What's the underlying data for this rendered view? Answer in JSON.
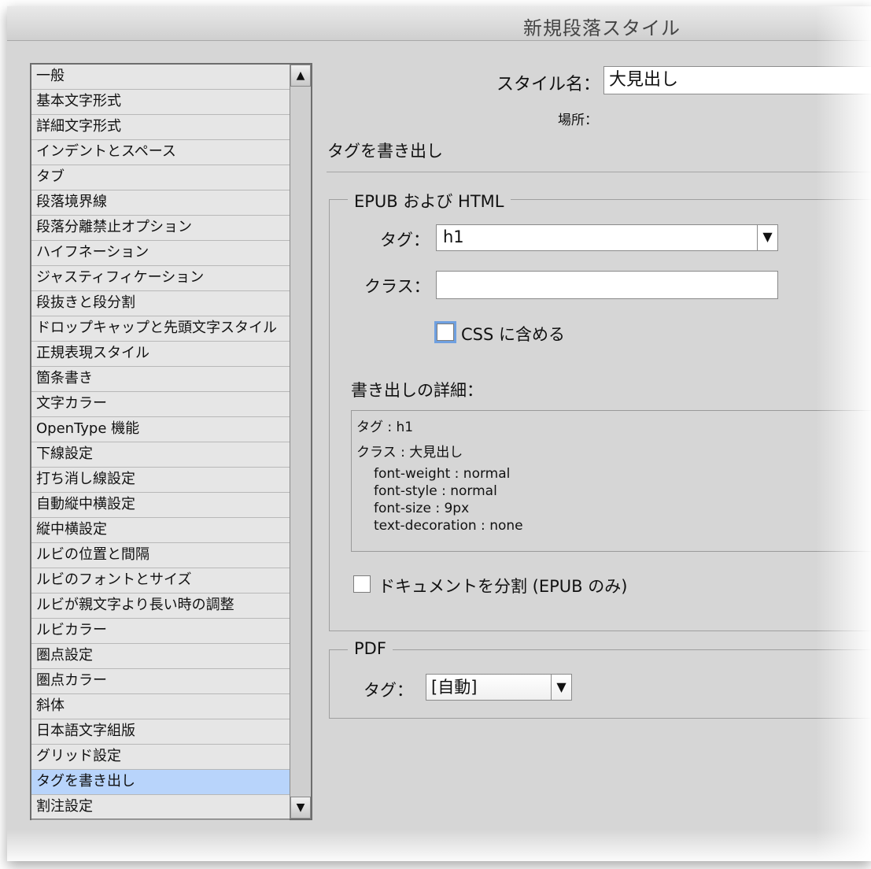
{
  "dialog": {
    "title": "新規段落スタイル"
  },
  "categories": [
    "一般",
    "基本文字形式",
    "詳細文字形式",
    "インデントとスペース",
    "タブ",
    "段落境界線",
    "段落分離禁止オプション",
    "ハイフネーション",
    "ジャスティフィケーション",
    "段抜きと段分割",
    "ドロップキャップと先頭文字スタイル",
    "正規表現スタイル",
    "箇条書き",
    "文字カラー",
    "OpenType 機能",
    "下線設定",
    "打ち消し線設定",
    "自動縦中横設定",
    "縦中横設定",
    "ルビの位置と間隔",
    "ルビのフォントとサイズ",
    "ルビが親文字より長い時の調整",
    "ルビカラー",
    "圏点設定",
    "圏点カラー",
    "斜体",
    "日本語文字組版",
    "グリッド設定",
    "タグを書き出し",
    "割注設定"
  ],
  "selected_category": "タグを書き出し",
  "scroll": {
    "up_icon": "▲",
    "down_icon": "▼"
  },
  "style_name": {
    "label": "スタイル名：",
    "value": "大見出し"
  },
  "location": {
    "label": "場所："
  },
  "section_heading": "タグを書き出し",
  "epub": {
    "group_title": "EPUB および HTML",
    "tag_label": "タグ：",
    "tag_value": "h1",
    "class_label": "クラス：",
    "class_value": "",
    "include_css_label": "CSS に含める",
    "details_label": "書き出しの詳細：",
    "details": {
      "tag_line": "タグ : h1",
      "class_line": "クラス : 大見出し",
      "props": [
        "font-weight : normal",
        "font-style : normal",
        "font-size : 9px",
        "text-decoration : none"
      ]
    },
    "split_doc_label": "ドキュメントを分割 (EPUB のみ)"
  },
  "pdf": {
    "group_title": "PDF",
    "tag_label": "タグ：",
    "tag_value": "[自動]"
  },
  "icons": {
    "dropdown": "▼"
  }
}
